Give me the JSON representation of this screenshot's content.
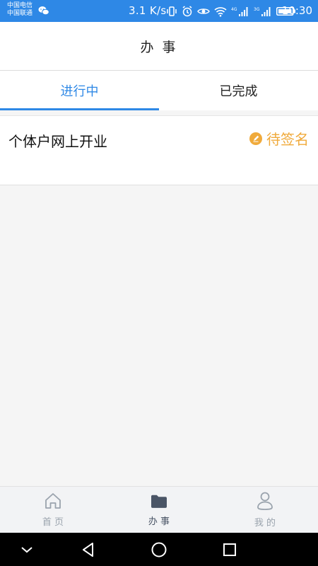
{
  "statusbar": {
    "carrier1": "中国电信",
    "carrier2": "中国联通",
    "net_speed": "3.1 K/s",
    "time": "10:30",
    "signal1_label": "4G",
    "signal2_label": "3G"
  },
  "header": {
    "title": "办 事"
  },
  "tabs": [
    {
      "label": "进行中",
      "active": true
    },
    {
      "label": "已完成",
      "active": false
    }
  ],
  "items": [
    {
      "title": "个体户网上开业",
      "status": "待签名",
      "status_color": "#f0aa3b"
    }
  ],
  "bottom_nav": [
    {
      "label": "首 页",
      "icon": "home-icon",
      "active": false
    },
    {
      "label": "办 事",
      "icon": "folder-icon",
      "active": true
    },
    {
      "label": "我 的",
      "icon": "user-icon",
      "active": false
    }
  ],
  "colors": {
    "accent": "#2e88e6",
    "status_pending": "#f0aa3b",
    "background": "#f5f5f5"
  }
}
